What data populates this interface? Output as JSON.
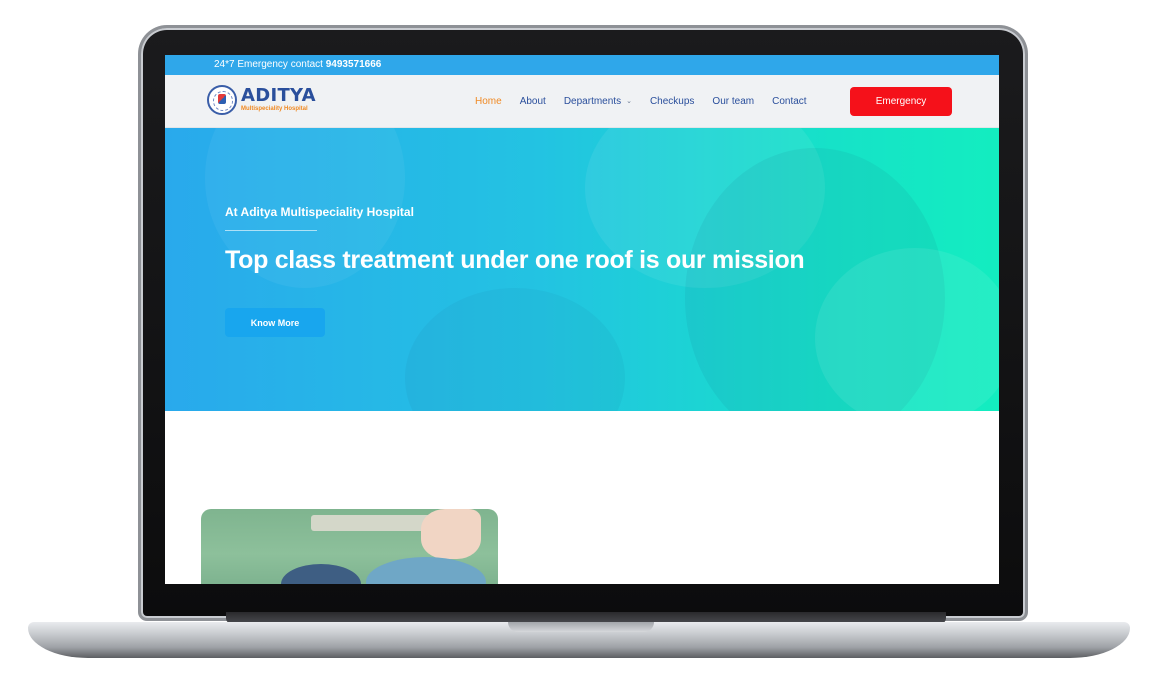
{
  "topbar": {
    "prefix": "24*7 Emergency contact",
    "phone": "9493571666"
  },
  "logo": {
    "name": "ADITYA",
    "subtitle": "Multispeciality Hospital"
  },
  "nav": {
    "items": [
      {
        "label": "Home",
        "active": true
      },
      {
        "label": "About"
      },
      {
        "label": "Departments",
        "dropdown": true
      },
      {
        "label": "Checkups"
      },
      {
        "label": "Our team"
      },
      {
        "label": "Contact"
      }
    ],
    "emergency_label": "Emergency"
  },
  "hero": {
    "subtitle": "At Aditya Multispeciality Hospital",
    "title": "Top class treatment under one roof is our mission",
    "button_label": "Know More"
  },
  "colors": {
    "topbar": "#2fa7ea",
    "active_nav": "#f08a24",
    "nav_text": "#2a4f9c",
    "emergency": "#f5111a",
    "hero_start": "#29a9ec",
    "hero_end": "#13edc0"
  },
  "icons": {
    "dropdown": "chevron-down-icon",
    "logo": "hospital-seal-icon"
  }
}
